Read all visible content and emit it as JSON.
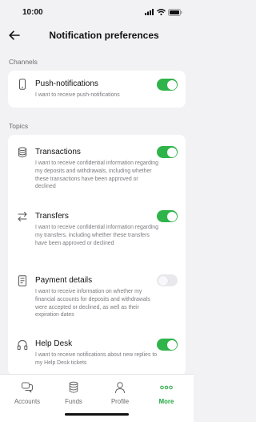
{
  "status": {
    "time": "10:00"
  },
  "header": {
    "title": "Notification preferences"
  },
  "sections": {
    "channels": "Channels",
    "topics": "Topics"
  },
  "channels": [
    {
      "icon": "phone-icon",
      "name": "Push-notifications",
      "desc": "I want to receive push-notifications",
      "enabled": true
    }
  ],
  "topics": [
    {
      "icon": "database-icon",
      "name": "Transactions",
      "desc": "I want to receive confidential information regarding my deposits and withdrawals, including whether these transactions have been approved or declined",
      "enabled": true
    },
    {
      "icon": "transfer-arrows-icon",
      "name": "Transfers",
      "desc": "I want to receive confidential information regarding my transfers, including whether these transfers have been approved or declined",
      "enabled": true
    },
    {
      "icon": "document-icon",
      "name": "Payment details",
      "desc": "I want to receive information on whether my financial accounts for deposits and withdrawals were accepted or declined, as well as their expiration dates",
      "enabled": false
    },
    {
      "icon": "headphones-icon",
      "name": "Help Desk",
      "desc": "I want to receive notifications about new replies to my Help Desk tickets",
      "enabled": true
    }
  ],
  "tabbar": [
    {
      "icon": "accounts-chat-icon",
      "label": "Accounts",
      "active": false
    },
    {
      "icon": "funds-coins-icon",
      "label": "Funds",
      "active": false
    },
    {
      "icon": "profile-person-icon",
      "label": "Profile",
      "active": false
    },
    {
      "icon": "more-dots-icon",
      "label": "More",
      "active": true
    }
  ],
  "colors": {
    "accent": "#2fb44a",
    "background": "#f2f2f4",
    "card": "#ffffff"
  }
}
